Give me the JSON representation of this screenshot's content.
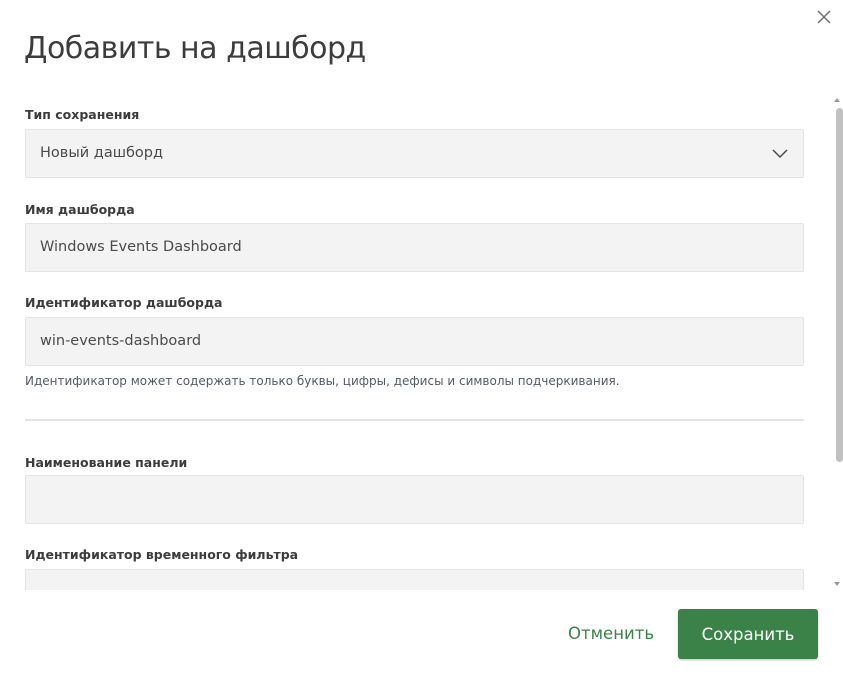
{
  "dialog": {
    "title": "Добавить на дашборд",
    "close_icon": "close-icon"
  },
  "form": {
    "save_type": {
      "label": "Тип сохранения",
      "value": "Новый дашборд",
      "icon": "chevron-down-icon"
    },
    "dashboard_name": {
      "label": "Имя дашборда",
      "value": "Windows Events Dashboard"
    },
    "dashboard_id": {
      "label": "Идентификатор дашборда",
      "value": "win-events-dashboard",
      "hint": "Идентификатор может содержать только буквы, цифры, дефисы и символы подчеркивания."
    },
    "panel_name": {
      "label": "Наименование панели",
      "value": ""
    },
    "time_filter_id": {
      "label": "Идентификатор временного фильтра",
      "value": ""
    }
  },
  "footer": {
    "cancel_label": "Отменить",
    "save_label": "Сохранить"
  },
  "colors": {
    "accent": "#3b8249",
    "input_bg": "#f3f3f4",
    "input_border": "#e3e4e6",
    "divider": "#e4e5e7"
  }
}
